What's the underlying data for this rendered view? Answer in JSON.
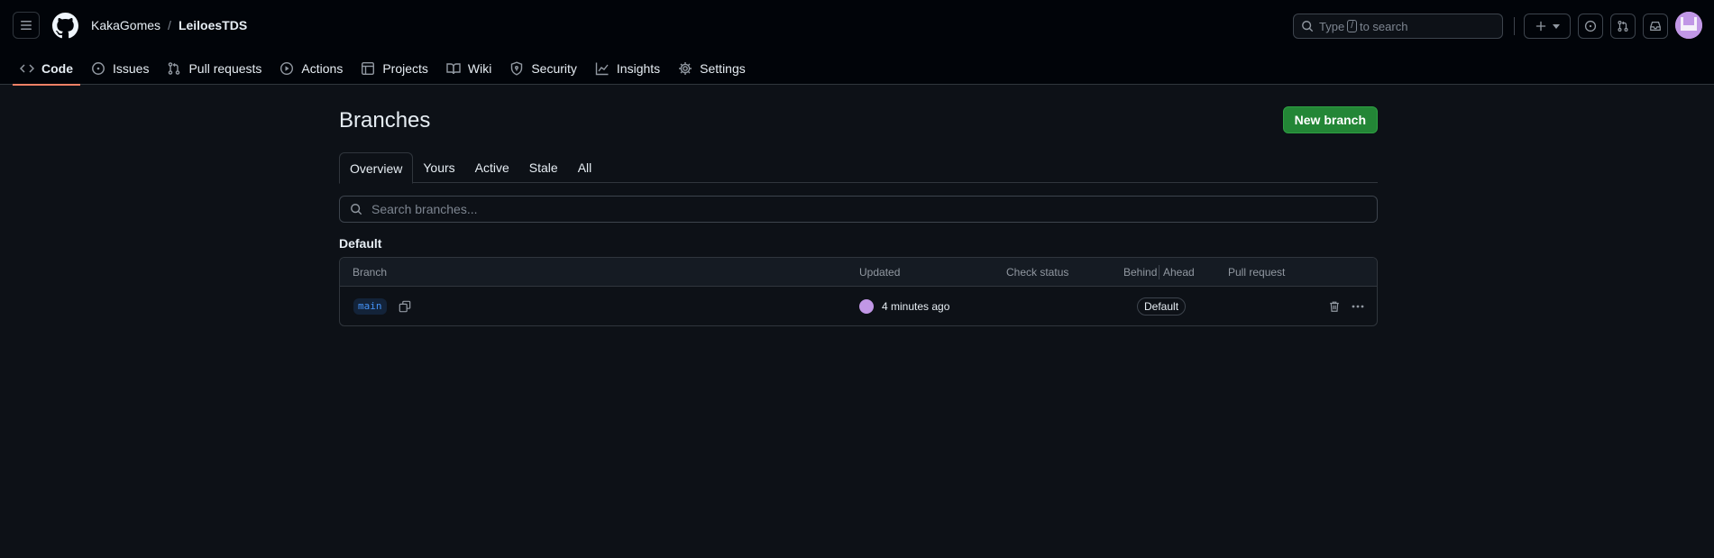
{
  "header": {
    "owner": "KakaGomes",
    "separator": "/",
    "repo": "LeiloesTDS",
    "search": {
      "prefix": "Type",
      "key": "/",
      "suffix": "to search"
    }
  },
  "nav": {
    "items": [
      {
        "label": "Code",
        "icon": "code-icon",
        "active": true
      },
      {
        "label": "Issues",
        "icon": "issue-icon"
      },
      {
        "label": "Pull requests",
        "icon": "pull-request-icon"
      },
      {
        "label": "Actions",
        "icon": "play-icon"
      },
      {
        "label": "Projects",
        "icon": "table-icon"
      },
      {
        "label": "Wiki",
        "icon": "book-icon"
      },
      {
        "label": "Security",
        "icon": "shield-icon"
      },
      {
        "label": "Insights",
        "icon": "graph-icon"
      },
      {
        "label": "Settings",
        "icon": "gear-icon"
      }
    ]
  },
  "page": {
    "title": "Branches",
    "new_branch_label": "New branch",
    "tabs": [
      "Overview",
      "Yours",
      "Active",
      "Stale",
      "All"
    ],
    "search_placeholder": "Search branches...",
    "section": "Default"
  },
  "table": {
    "columns": {
      "branch": "Branch",
      "updated": "Updated",
      "check_status": "Check status",
      "behind": "Behind",
      "ahead": "Ahead",
      "pull_request": "Pull request"
    },
    "rows": [
      {
        "branch": "main",
        "updated": "4 minutes ago",
        "badge": "Default"
      }
    ]
  },
  "colors": {
    "accent_primary": "#238636",
    "active_tab_underline": "#f78166",
    "branch_link": "#4493f8"
  }
}
